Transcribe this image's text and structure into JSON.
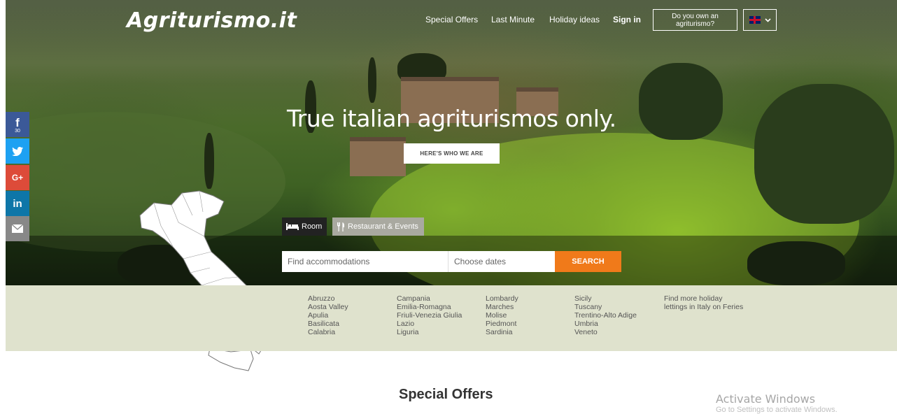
{
  "header": {
    "logo": "Agriturismo.it",
    "nav": [
      "Special Offers",
      "Last Minute",
      "Holiday ideas"
    ],
    "sign_in": "Sign in",
    "own_button": "Do you own an agriturismo?",
    "language_flag": "uk-flag-icon"
  },
  "hero": {
    "headline": "True italian agriturismos only.",
    "who_button": "HERE'S WHO WE ARE"
  },
  "tabs": {
    "room": "Room",
    "restaurant": "Restaurant & Events"
  },
  "search": {
    "accommodations_placeholder": "Find accommodations",
    "dates_placeholder": "Choose dates",
    "button": "SEARCH"
  },
  "social": {
    "facebook_count": "30",
    "icons": [
      "facebook-icon",
      "twitter-icon",
      "google-plus-icon",
      "linkedin-icon",
      "email-icon"
    ],
    "colors": {
      "facebook": "#3b5998",
      "twitter": "#1da1f2",
      "google": "#dd4b39",
      "linkedin": "#0e76a8",
      "email": "#888888"
    }
  },
  "regions": {
    "col1": [
      "Abruzzo",
      "Aosta Valley",
      "Apulia",
      "Basilicata",
      "Calabria"
    ],
    "col2": [
      "Campania",
      "Emilia-Romagna",
      "Friuli-Venezia Giulia",
      "Lazio",
      "Liguria"
    ],
    "col3": [
      "Lombardy",
      "Marches",
      "Molise",
      "Piedmont",
      "Sardinia"
    ],
    "col4": [
      "Sicily",
      "Tuscany",
      "Trentino-Alto Adige",
      "Umbria",
      "Veneto"
    ],
    "more": [
      "Find more holiday",
      "lettings in Italy on Feries"
    ]
  },
  "sections": {
    "special_offers": "Special Offers"
  },
  "overlay": {
    "activate": "Activate Windows",
    "activate_sub": "Go to Settings to activate Windows."
  },
  "colors": {
    "accent_orange": "#f07a1a",
    "region_band": "#dfe2cd"
  }
}
